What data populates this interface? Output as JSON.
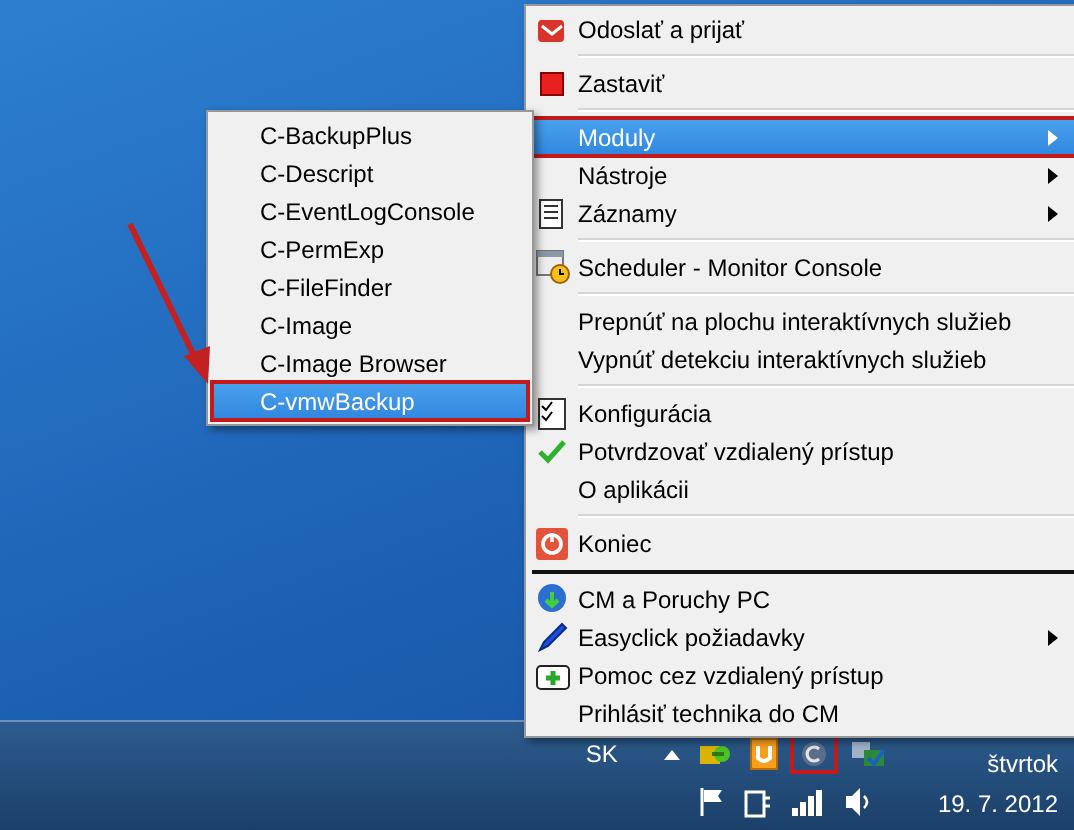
{
  "menu": {
    "items": [
      {
        "kind": "item",
        "label": "Odoslať a prijať",
        "selected": false,
        "checked": false,
        "submenu": false
      },
      {
        "kind": "separator"
      },
      {
        "kind": "item",
        "label": "Zastaviť",
        "selected": false,
        "checked": false,
        "submenu": false
      },
      {
        "kind": "separator"
      },
      {
        "kind": "item",
        "label": "Moduly",
        "selected": true,
        "checked": false,
        "submenu": true
      },
      {
        "kind": "item",
        "label": "Nástroje",
        "selected": false,
        "checked": false,
        "submenu": true
      },
      {
        "kind": "item",
        "label": "Záznamy",
        "selected": false,
        "checked": false,
        "submenu": true
      },
      {
        "kind": "separator"
      },
      {
        "kind": "item",
        "label": "Scheduler - Monitor Console",
        "selected": false,
        "checked": false,
        "submenu": false
      },
      {
        "kind": "separator"
      },
      {
        "kind": "item",
        "label": "Prepnúť na plochu interaktívnych služieb",
        "selected": false,
        "checked": false,
        "submenu": false
      },
      {
        "kind": "item",
        "label": "Vypnúť detekciu interaktívnych služieb",
        "selected": false,
        "checked": false,
        "submenu": false
      },
      {
        "kind": "separator"
      },
      {
        "kind": "item",
        "label": "Konfigurácia",
        "selected": false,
        "checked": false,
        "submenu": false
      },
      {
        "kind": "item",
        "label": "Potvrdzovať vzdialený prístup",
        "selected": false,
        "checked": true,
        "submenu": false
      },
      {
        "kind": "item",
        "label": "O aplikácii",
        "selected": false,
        "checked": false,
        "submenu": false
      },
      {
        "kind": "separator"
      },
      {
        "kind": "item",
        "label": "Koniec",
        "selected": false,
        "checked": false,
        "submenu": false
      },
      {
        "kind": "thick-separator"
      },
      {
        "kind": "item",
        "label": "CM a Poruchy PC",
        "selected": false,
        "checked": false,
        "submenu": false
      },
      {
        "kind": "item",
        "label": "Easyclick požiadavky",
        "selected": false,
        "checked": false,
        "submenu": true
      },
      {
        "kind": "item",
        "label": "Pomoc cez vzdialený prístup",
        "selected": false,
        "checked": false,
        "submenu": false
      },
      {
        "kind": "item",
        "label": "Prihlásiť technika do CM",
        "selected": false,
        "checked": false,
        "submenu": false
      }
    ]
  },
  "submenu": {
    "items": [
      {
        "label": "C-BackupPlus",
        "selected": false
      },
      {
        "label": "C-Descript",
        "selected": false
      },
      {
        "label": "C-EventLogConsole",
        "selected": false
      },
      {
        "label": "C-PermExp",
        "selected": false
      },
      {
        "label": "C-FileFinder",
        "selected": false
      },
      {
        "label": "C-Image",
        "selected": false
      },
      {
        "label": "C-Image Browser",
        "selected": false
      },
      {
        "label": "C-vmwBackup",
        "selected": true
      }
    ]
  },
  "taskbar": {
    "language": "SK",
    "day": "štvrtok",
    "date": "19. 7. 2012"
  }
}
